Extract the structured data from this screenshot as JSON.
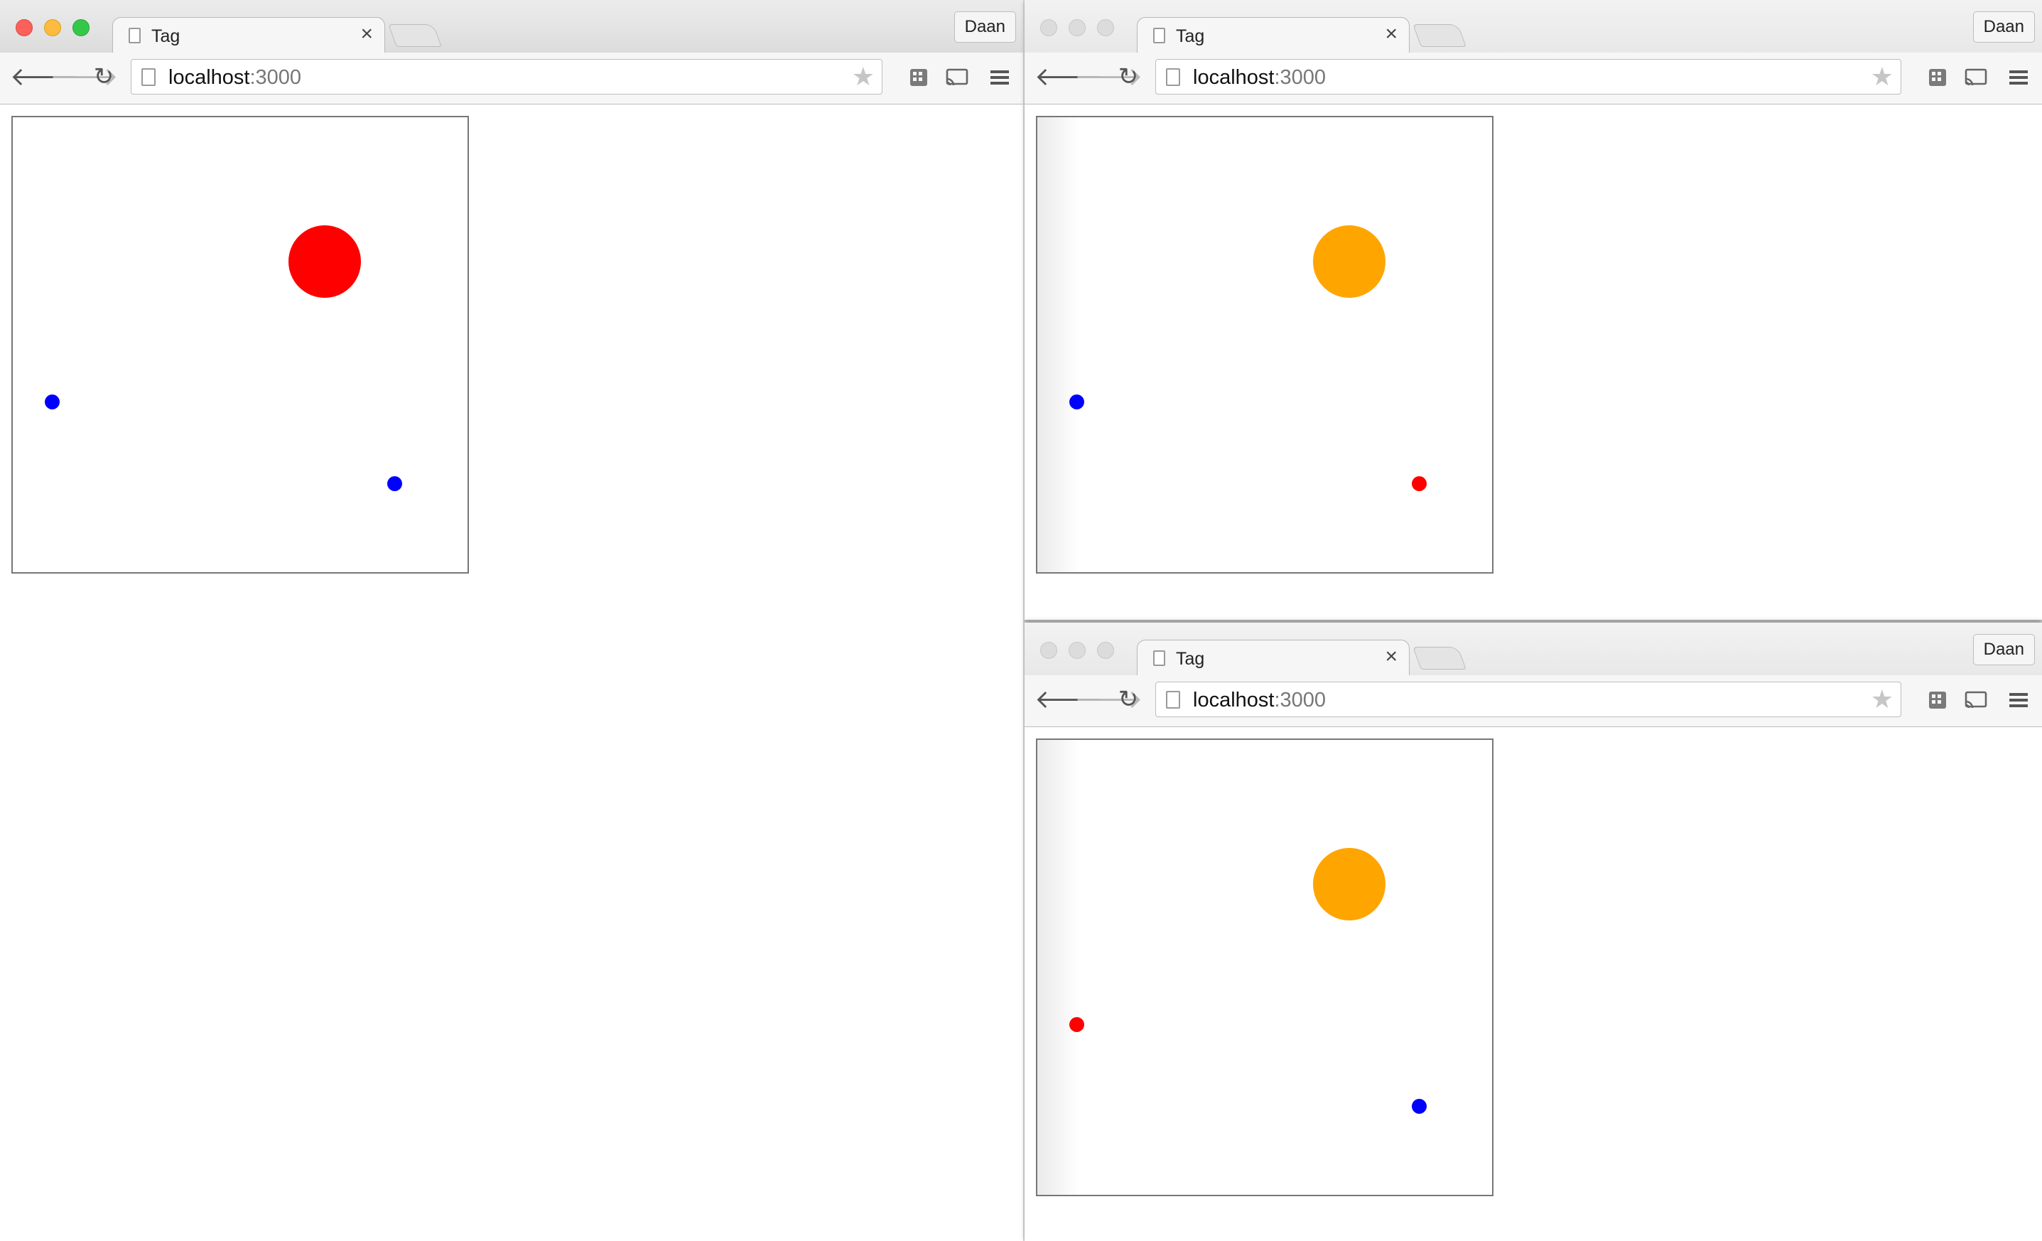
{
  "windows": [
    {
      "id": "w1",
      "active": true,
      "tab_title": "Tag",
      "url_host": "localhost",
      "url_port": ":3000",
      "profile": "Daan",
      "game": {
        "tagger_color": "#ff0000",
        "players": [
          {
            "role": "it",
            "color": "#ff0000"
          },
          {
            "role": "runner",
            "color": "#0000ff"
          },
          {
            "role": "runner",
            "color": "#0000ff"
          }
        ]
      }
    },
    {
      "id": "w2",
      "active": false,
      "tab_title": "Tag",
      "url_host": "localhost",
      "url_port": ":3000",
      "profile": "Daan",
      "game": {
        "players": [
          {
            "role": "it",
            "color": "#ffa500"
          },
          {
            "role": "runner",
            "color": "#0000ff"
          },
          {
            "role": "self",
            "color": "#ff0000"
          }
        ]
      }
    },
    {
      "id": "w3",
      "active": false,
      "tab_title": "Tag",
      "url_host": "localhost",
      "url_port": ":3000",
      "profile": "Daan",
      "game": {
        "players": [
          {
            "role": "it",
            "color": "#ffa500"
          },
          {
            "role": "self",
            "color": "#ff0000"
          },
          {
            "role": "runner",
            "color": "#0000ff"
          }
        ]
      }
    }
  ],
  "icons": {
    "back": "back-arrow-icon",
    "forward": "forward-arrow-icon",
    "reload": "reload-icon",
    "star": "bookmark-star-icon",
    "extension": "extension-icon",
    "cast": "cast-icon",
    "menu": "hamburger-menu-icon",
    "close": "close-icon",
    "page": "page-icon"
  }
}
